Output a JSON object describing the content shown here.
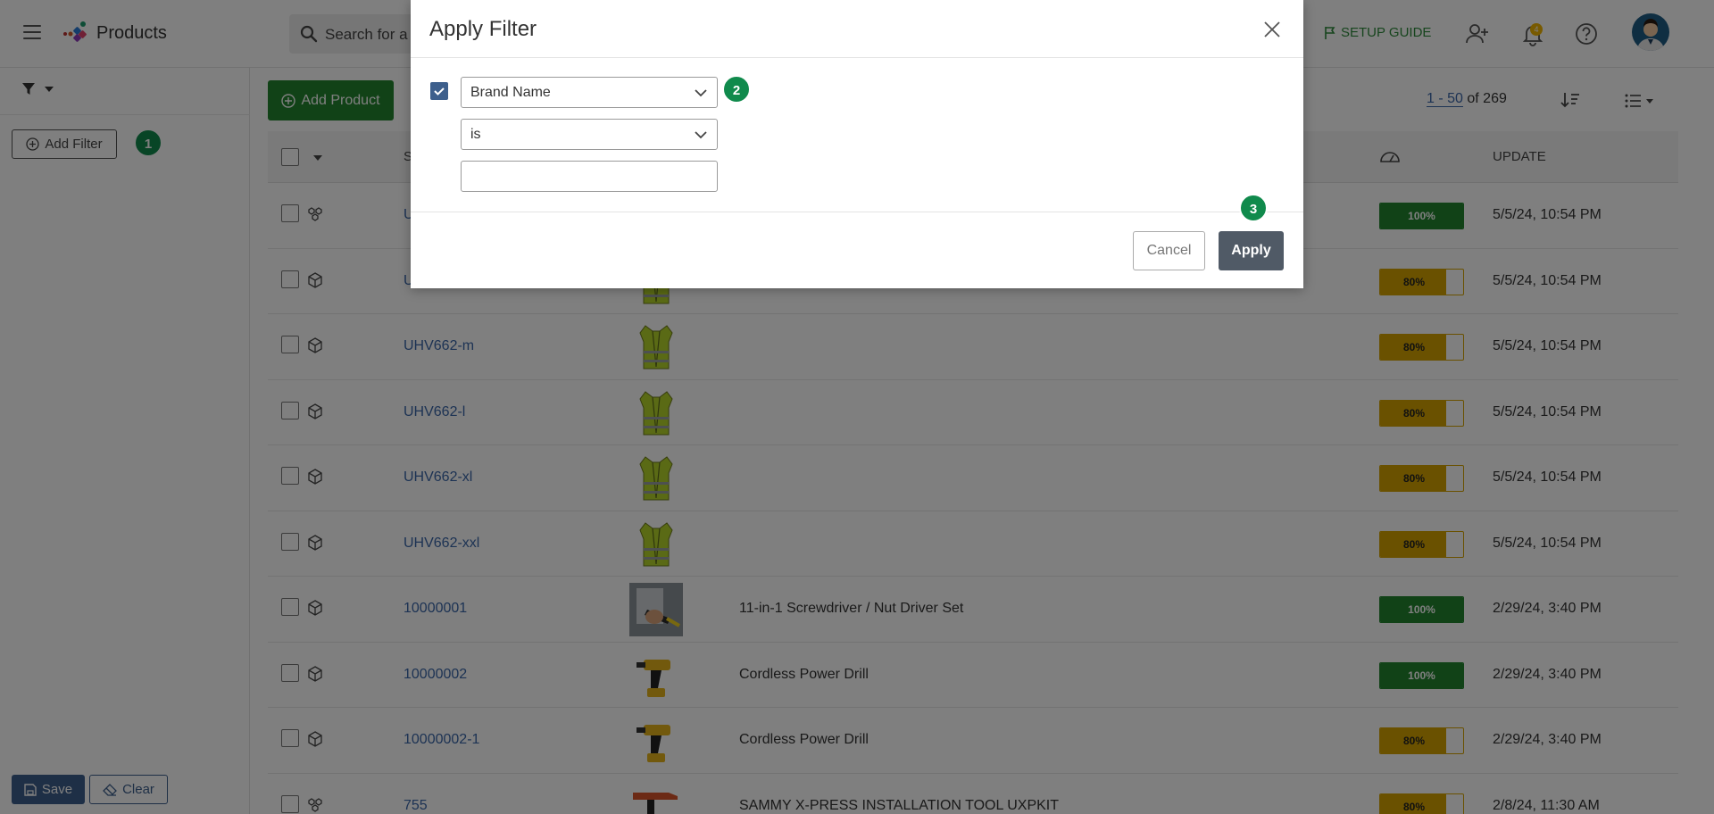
{
  "app": {
    "title": "Products"
  },
  "search": {
    "placeholder": "Search for a"
  },
  "topbar": {
    "setup_guide": "SETUP GUIDE",
    "notification_count": "4"
  },
  "sidebar": {
    "add_filter_label": "Add Filter",
    "save_label": "Save",
    "clear_label": "Clear"
  },
  "toolbar": {
    "add_product_label": "Add Product",
    "pagination_range": "1 - 50",
    "pagination_total": "of 269"
  },
  "table": {
    "headers": {
      "sku_partial": "S",
      "update": "UPDATE"
    },
    "rows": [
      {
        "sku": "U",
        "name": "",
        "score": "100%",
        "score_pct": 100,
        "updated": "5/5/24, 10:54 PM",
        "type": "bundle-icon",
        "thumb": "none"
      },
      {
        "sku": "U",
        "name": "",
        "score": "80%",
        "score_pct": 80,
        "updated": "5/5/24, 10:54 PM",
        "type": "box-icon",
        "thumb": "vest"
      },
      {
        "sku": "UHV662-m",
        "name": "",
        "score": "80%",
        "score_pct": 80,
        "updated": "5/5/24, 10:54 PM",
        "type": "box-icon",
        "thumb": "vest"
      },
      {
        "sku": "UHV662-l",
        "name": "",
        "score": "80%",
        "score_pct": 80,
        "updated": "5/5/24, 10:54 PM",
        "type": "box-icon",
        "thumb": "vest"
      },
      {
        "sku": "UHV662-xl",
        "name": "",
        "score": "80%",
        "score_pct": 80,
        "updated": "5/5/24, 10:54 PM",
        "type": "box-icon",
        "thumb": "vest"
      },
      {
        "sku": "UHV662-xxl",
        "name": "",
        "score": "80%",
        "score_pct": 80,
        "updated": "5/5/24, 10:54 PM",
        "type": "box-icon",
        "thumb": "vest"
      },
      {
        "sku": "10000001",
        "name": "11-in-1 Screwdriver / Nut Driver Set",
        "score": "100%",
        "score_pct": 100,
        "updated": "2/29/24, 3:40 PM",
        "type": "box-icon",
        "thumb": "screwdriver"
      },
      {
        "sku": "10000002",
        "name": "Cordless Power Drill",
        "score": "100%",
        "score_pct": 100,
        "updated": "2/29/24, 3:40 PM",
        "type": "box-icon",
        "thumb": "drill"
      },
      {
        "sku": "10000002-1",
        "name": "Cordless Power Drill",
        "score": "80%",
        "score_pct": 80,
        "updated": "2/29/24, 3:40 PM",
        "type": "box-icon",
        "thumb": "drill"
      },
      {
        "sku": "755",
        "name": "SAMMY X-PRESS INSTALLATION TOOL UXPKIT",
        "score": "80%",
        "score_pct": 80,
        "updated": "2/8/24, 11:30 AM",
        "type": "bundle-icon",
        "thumb": "tool"
      }
    ]
  },
  "modal": {
    "title": "Apply Filter",
    "field_select": "Brand Name",
    "operator_select": "is",
    "value_input": "",
    "cancel_label": "Cancel",
    "apply_label": "Apply"
  },
  "steps": {
    "one": "1",
    "two": "2",
    "three": "3"
  },
  "colors": {
    "primary_green": "#23852f",
    "score_full": "#23852f",
    "score_partial": "#d4a300",
    "link_blue": "#3a66a8",
    "save_blue": "#3d5f8c",
    "apply_gray": "#505a66",
    "step_badge": "#108a4c"
  }
}
